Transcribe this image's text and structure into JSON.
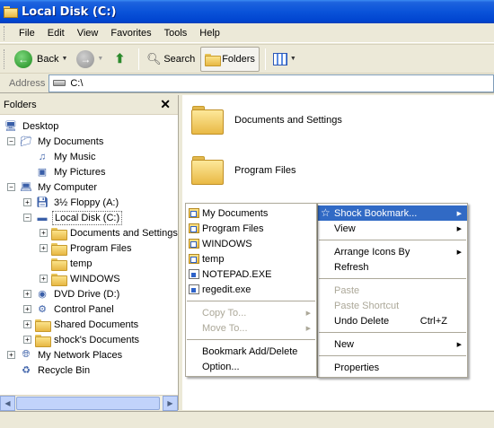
{
  "window": {
    "title": "Local Disk (C:)"
  },
  "menubar": {
    "items": [
      "File",
      "Edit",
      "View",
      "Favorites",
      "Tools",
      "Help"
    ]
  },
  "toolbar": {
    "back_label": "Back",
    "search_label": "Search",
    "folders_label": "Folders"
  },
  "address": {
    "label": "Address",
    "value": "C:\\"
  },
  "folders_pane": {
    "title": "Folders",
    "tree": [
      {
        "label": "Desktop",
        "icon": "desktop-icon",
        "expander": "",
        "level": 0
      },
      {
        "label": "My Documents",
        "icon": "my-documents-icon",
        "expander": "−",
        "level": 1
      },
      {
        "label": "My Music",
        "icon": "music-folder-icon",
        "expander": "",
        "level": 2
      },
      {
        "label": "My Pictures",
        "icon": "pictures-folder-icon",
        "expander": "",
        "level": 2
      },
      {
        "label": "My Computer",
        "icon": "my-computer-icon",
        "expander": "−",
        "level": 1
      },
      {
        "label": "3½ Floppy (A:)",
        "icon": "floppy-drive-icon",
        "expander": "+",
        "level": 2
      },
      {
        "label": "Local Disk (C:)",
        "icon": "hard-drive-icon",
        "expander": "−",
        "level": 2
      },
      {
        "label": "Documents and Settings",
        "icon": "folder-icon",
        "expander": "+",
        "level": 3
      },
      {
        "label": "Program Files",
        "icon": "folder-icon",
        "expander": "+",
        "level": 3
      },
      {
        "label": "temp",
        "icon": "folder-icon",
        "expander": "",
        "level": 3
      },
      {
        "label": "WINDOWS",
        "icon": "folder-icon",
        "expander": "+",
        "level": 3
      },
      {
        "label": "DVD Drive (D:)",
        "icon": "dvd-drive-icon",
        "expander": "+",
        "level": 2
      },
      {
        "label": "Control Panel",
        "icon": "control-panel-icon",
        "expander": "+",
        "level": 2
      },
      {
        "label": "Shared Documents",
        "icon": "folder-icon",
        "expander": "+",
        "level": 2
      },
      {
        "label": "shock's Documents",
        "icon": "folder-icon",
        "expander": "+",
        "level": 2
      },
      {
        "label": "My Network Places",
        "icon": "network-places-icon",
        "expander": "+",
        "level": 1
      },
      {
        "label": "Recycle Bin",
        "icon": "recycle-bin-icon",
        "expander": "",
        "level": 1
      }
    ]
  },
  "content": {
    "items": [
      {
        "label": "Documents and Settings"
      },
      {
        "label": "Program Files"
      }
    ]
  },
  "context_menu": {
    "items": [
      {
        "label": "Shock Bookmark...",
        "arrow": "▶",
        "shortcut": ""
      },
      {
        "label": "View",
        "arrow": "▶",
        "shortcut": ""
      },
      {
        "label": "Arrange Icons By",
        "arrow": "▶",
        "shortcut": ""
      },
      {
        "label": "Refresh",
        "arrow": "",
        "shortcut": ""
      },
      {
        "label": "Paste",
        "arrow": "",
        "shortcut": ""
      },
      {
        "label": "Paste Shortcut",
        "arrow": "",
        "shortcut": ""
      },
      {
        "label": "Undo Delete",
        "arrow": "",
        "shortcut": "Ctrl+Z"
      },
      {
        "label": "New",
        "arrow": "▶",
        "shortcut": ""
      },
      {
        "label": "Properties",
        "arrow": "",
        "shortcut": ""
      }
    ]
  },
  "bookmark_submenu": {
    "items": [
      {
        "label": "My Documents",
        "arrow": ""
      },
      {
        "label": "Program Files",
        "arrow": ""
      },
      {
        "label": "WINDOWS",
        "arrow": ""
      },
      {
        "label": "temp",
        "arrow": ""
      },
      {
        "label": "NOTEPAD.EXE",
        "arrow": ""
      },
      {
        "label": "regedit.exe",
        "arrow": ""
      },
      {
        "label": "Copy To...",
        "arrow": "▶"
      },
      {
        "label": "Move To...",
        "arrow": "▶"
      },
      {
        "label": "Bookmark Add/Delete",
        "arrow": ""
      },
      {
        "label": "Option...",
        "arrow": ""
      }
    ]
  }
}
